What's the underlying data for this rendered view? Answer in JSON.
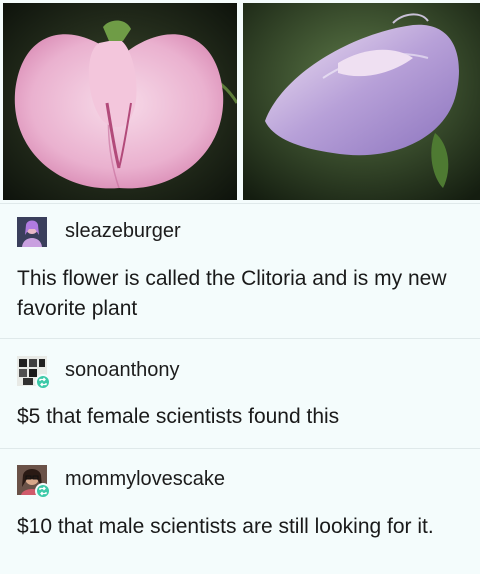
{
  "posts": [
    {
      "username": "sleazeburger",
      "avatar": "avatar-icon",
      "text": "This flower is called the Clitoria and is my new favorite plant"
    },
    {
      "username": "sonoanthony",
      "avatar": "avatar-icon",
      "reblog_icon": "reblog-icon",
      "text": "$5 that female scientists found this"
    },
    {
      "username": "mommylovescake",
      "avatar": "avatar-icon",
      "reblog_icon": "reblog-icon",
      "text": "$10 that male scientists are still looking for it."
    }
  ],
  "colors": {
    "background": "#f4fcfc",
    "reblog_badge": "#3cc9a8",
    "text": "#1a1a1a",
    "flower_pink": "#e8a9c8",
    "flower_purple": "#a58dcc"
  }
}
